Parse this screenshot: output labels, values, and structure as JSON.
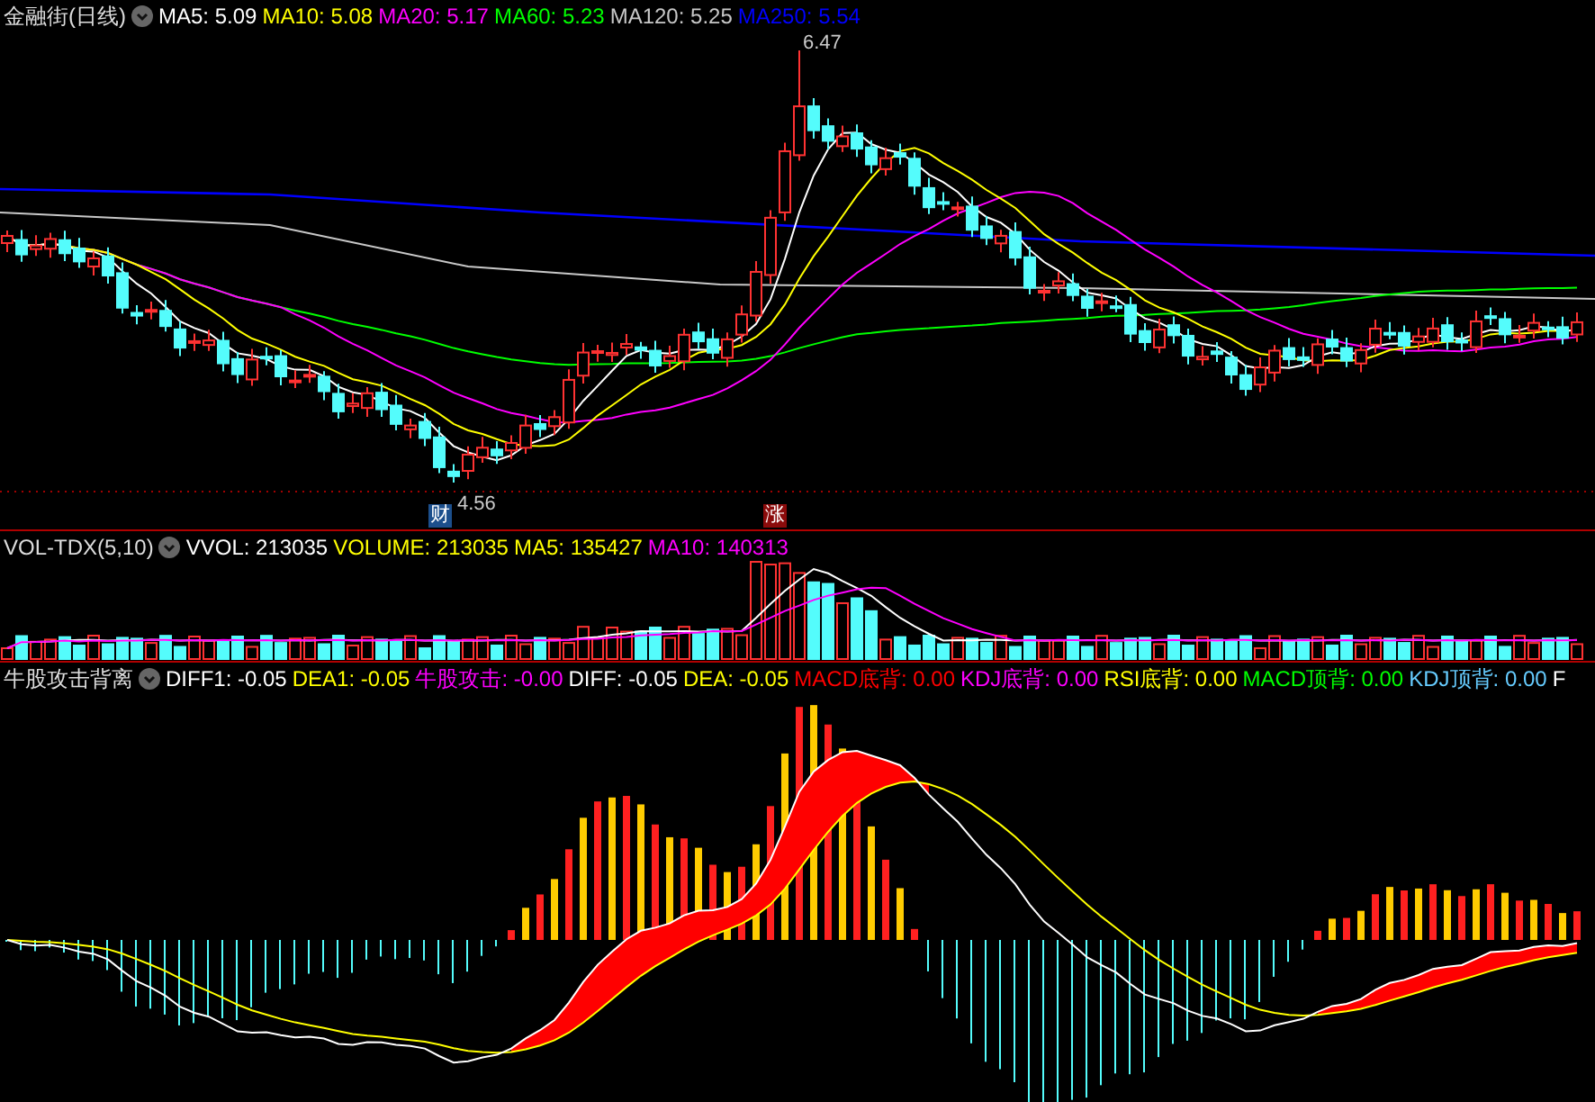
{
  "main_panel": {
    "title": "金融街(日线)",
    "indicators": [
      {
        "label": "MA5: 5.09",
        "color": "#ffffff"
      },
      {
        "label": "MA10: 5.08",
        "color": "#ffff00"
      },
      {
        "label": "MA20: 5.17",
        "color": "#ff00ff"
      },
      {
        "label": "MA60: 5.23",
        "color": "#00ff00"
      },
      {
        "label": "MA120: 5.25",
        "color": "#c8c8c8"
      },
      {
        "label": "MA250: 5.54",
        "color": "#0000ff"
      }
    ],
    "high_label": "6.47",
    "low_label": "4.56",
    "markers": [
      {
        "text": "财",
        "kind": "finance"
      },
      {
        "text": "涨",
        "kind": "rise"
      }
    ]
  },
  "volume_panel": {
    "title": "VOL-TDX(5,10)",
    "indicators": [
      {
        "label": "VVOL: 213035",
        "color": "#ffffff"
      },
      {
        "label": "VOLUME: 213035",
        "color": "#ffff00"
      },
      {
        "label": "MA5: 135427",
        "color": "#ffff00"
      },
      {
        "label": "MA10: 140313",
        "color": "#ff00ff"
      }
    ]
  },
  "indicator_panel": {
    "title": "牛股攻击背离",
    "indicators": [
      {
        "label": "DIFF1: -0.05",
        "color": "#ffffff"
      },
      {
        "label": "DEA1: -0.05",
        "color": "#ffff00"
      },
      {
        "label": "牛股攻击: -0.00",
        "color": "#ff00ff"
      },
      {
        "label": "DIFF: -0.05",
        "color": "#ffffff"
      },
      {
        "label": "DEA: -0.05",
        "color": "#ffff00"
      },
      {
        "label": "MACD底背: 0.00",
        "color": "#ff0000"
      },
      {
        "label": "KDJ底背: 0.00",
        "color": "#ff00ff"
      },
      {
        "label": "RSI底背: 0.00",
        "color": "#ffff00"
      },
      {
        "label": "MACD顶背: 0.00",
        "color": "#00ff00"
      },
      {
        "label": "KDJ顶背: 0.00",
        "color": "#66ccff"
      },
      {
        "label": "F",
        "color": "#ffffff"
      }
    ]
  }
}
